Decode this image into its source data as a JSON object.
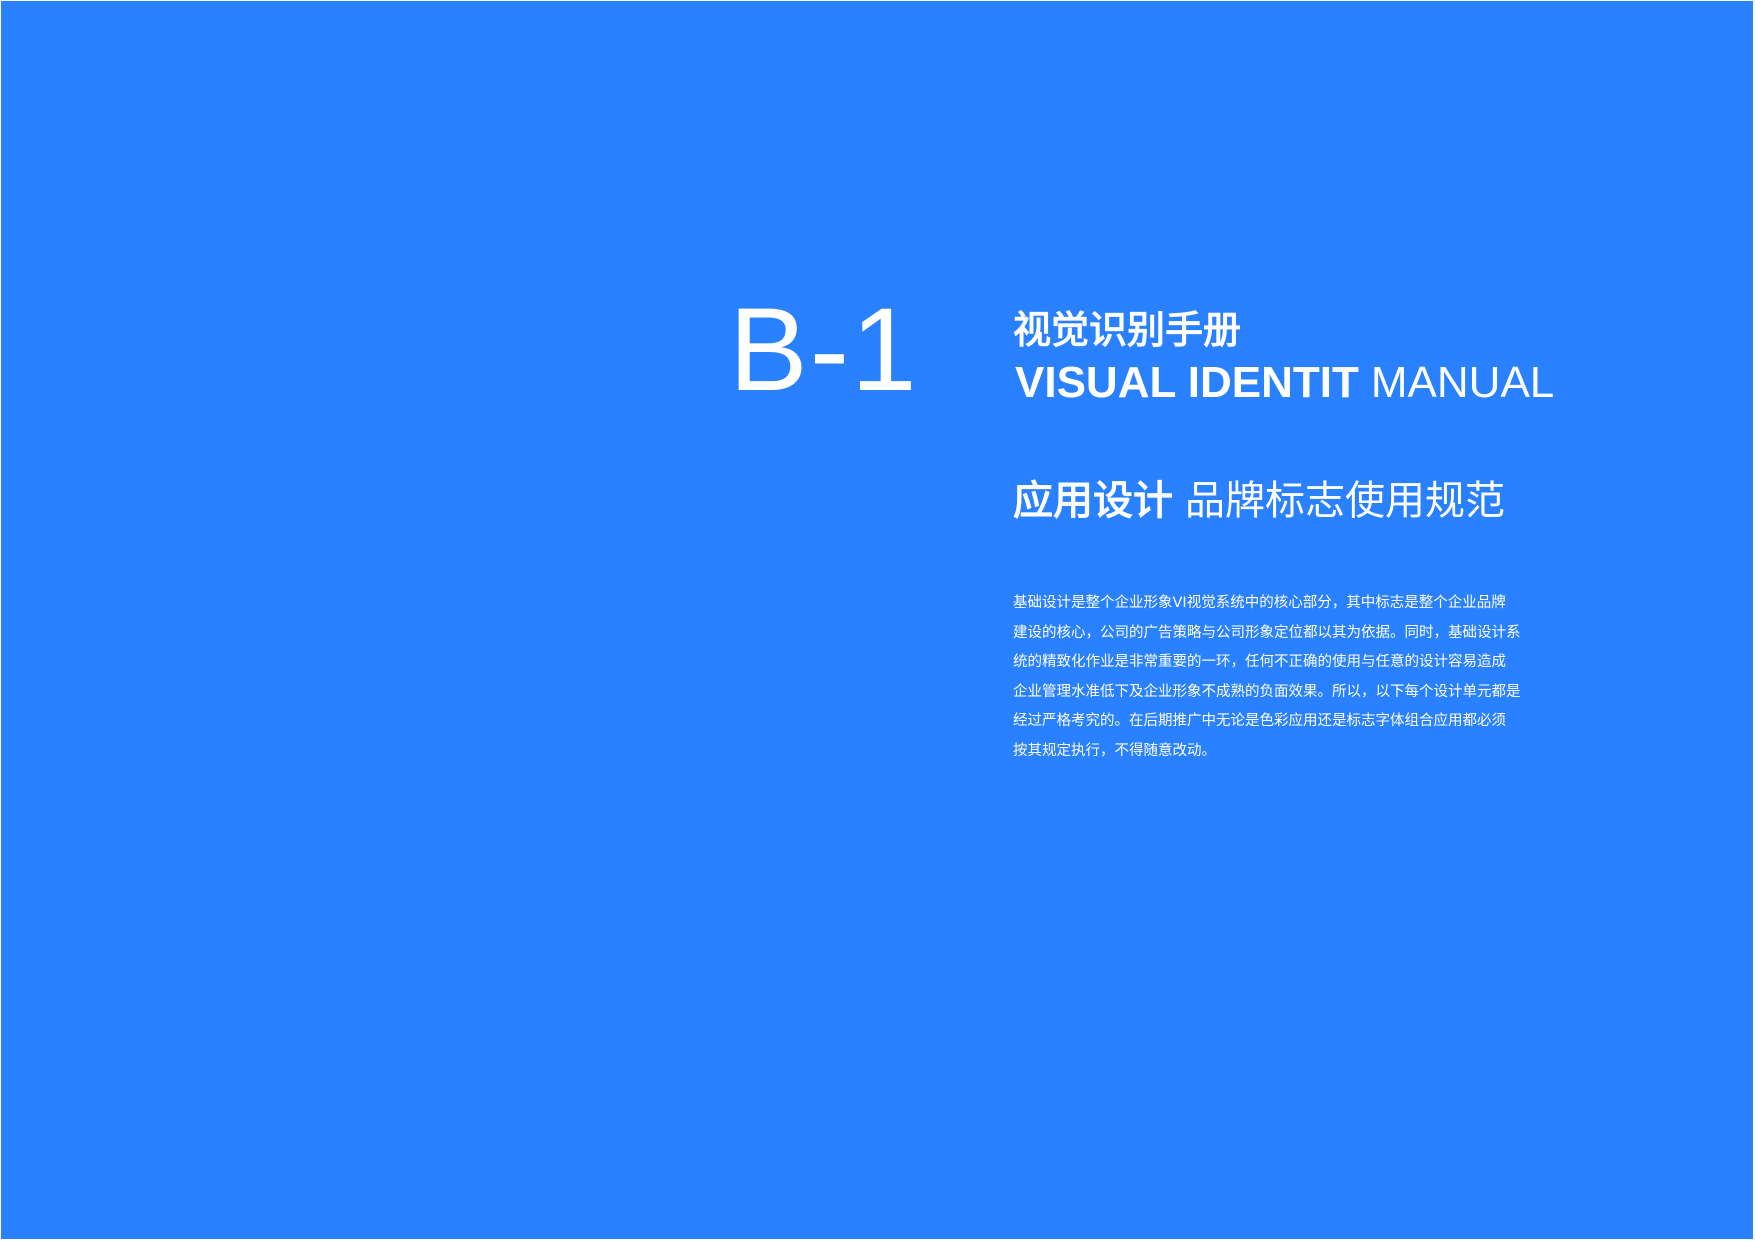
{
  "section": {
    "code": "B-1"
  },
  "title": {
    "cn": "视觉识别手册",
    "en_strong": "VISUAL IDENTIT",
    "en_light": "MANUAL"
  },
  "subtitle": {
    "strong": "应用设计",
    "light": "品牌标志使用规范"
  },
  "body": {
    "lines": [
      "基础设计是整个企业形象VI视觉系统中的核心部分，其中标志是整个企业品牌",
      "建设的核心，公司的广告策略与公司形象定位都以其为依据。同时，基础设计系",
      "统的精致化作业是非常重要的一环，任何不正确的使用与任意的设计容易造成",
      "企业管理水准低下及企业形象不成熟的负面效果。所以，以下每个设计单元都是",
      "经过严格考究的。在后期推广中无论是色彩应用还是标志字体组合应用都必须",
      "按其规定执行，不得随意改动。"
    ]
  },
  "colors": {
    "background": "#2981ff",
    "text": "#ffffff"
  }
}
